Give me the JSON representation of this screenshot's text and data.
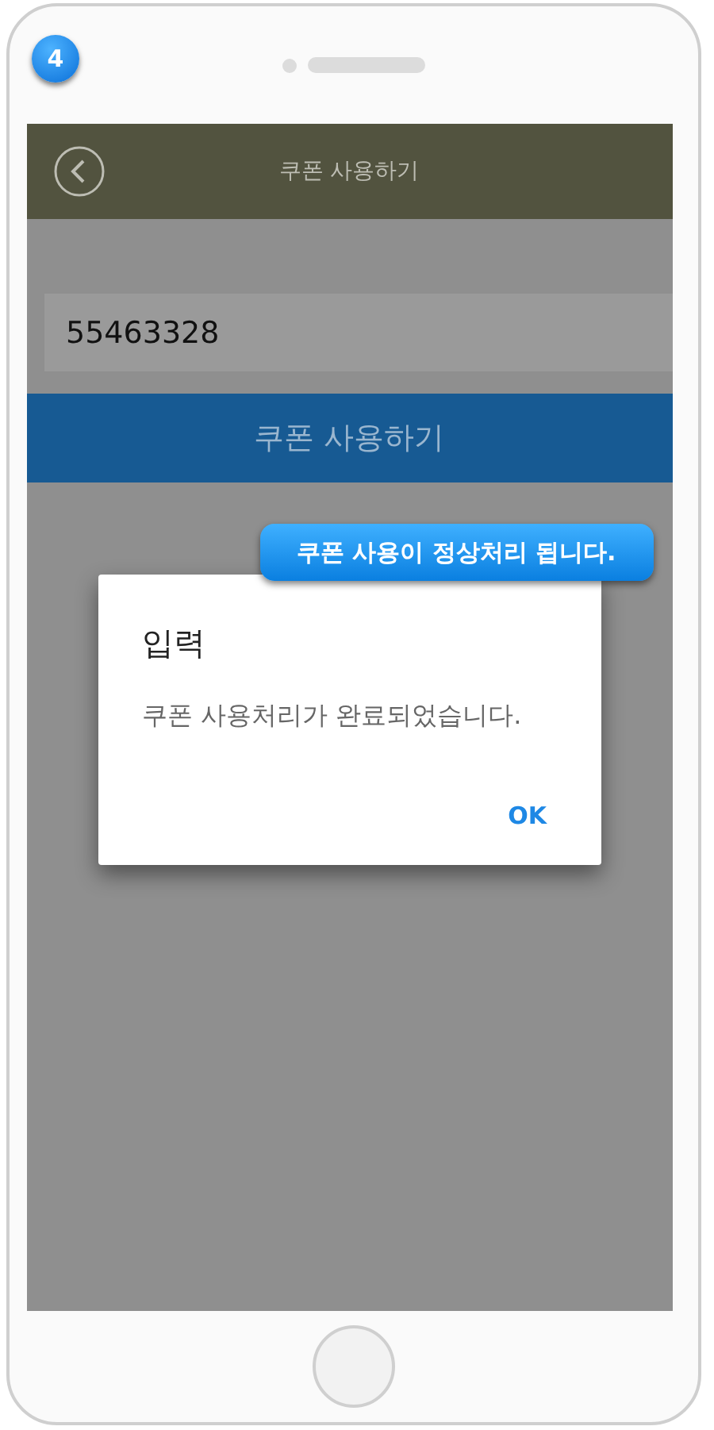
{
  "step_badge": "4",
  "header": {
    "title": "쿠폰 사용하기"
  },
  "coupon_field": {
    "value": "55463328"
  },
  "use_button": {
    "label": "쿠폰 사용하기"
  },
  "callout": "쿠폰 사용이 정상처리 됩니다.",
  "dialog": {
    "title": "입력",
    "message": "쿠폰 사용처리가 완료되었습니다.",
    "buttons": [
      "OK"
    ]
  }
}
